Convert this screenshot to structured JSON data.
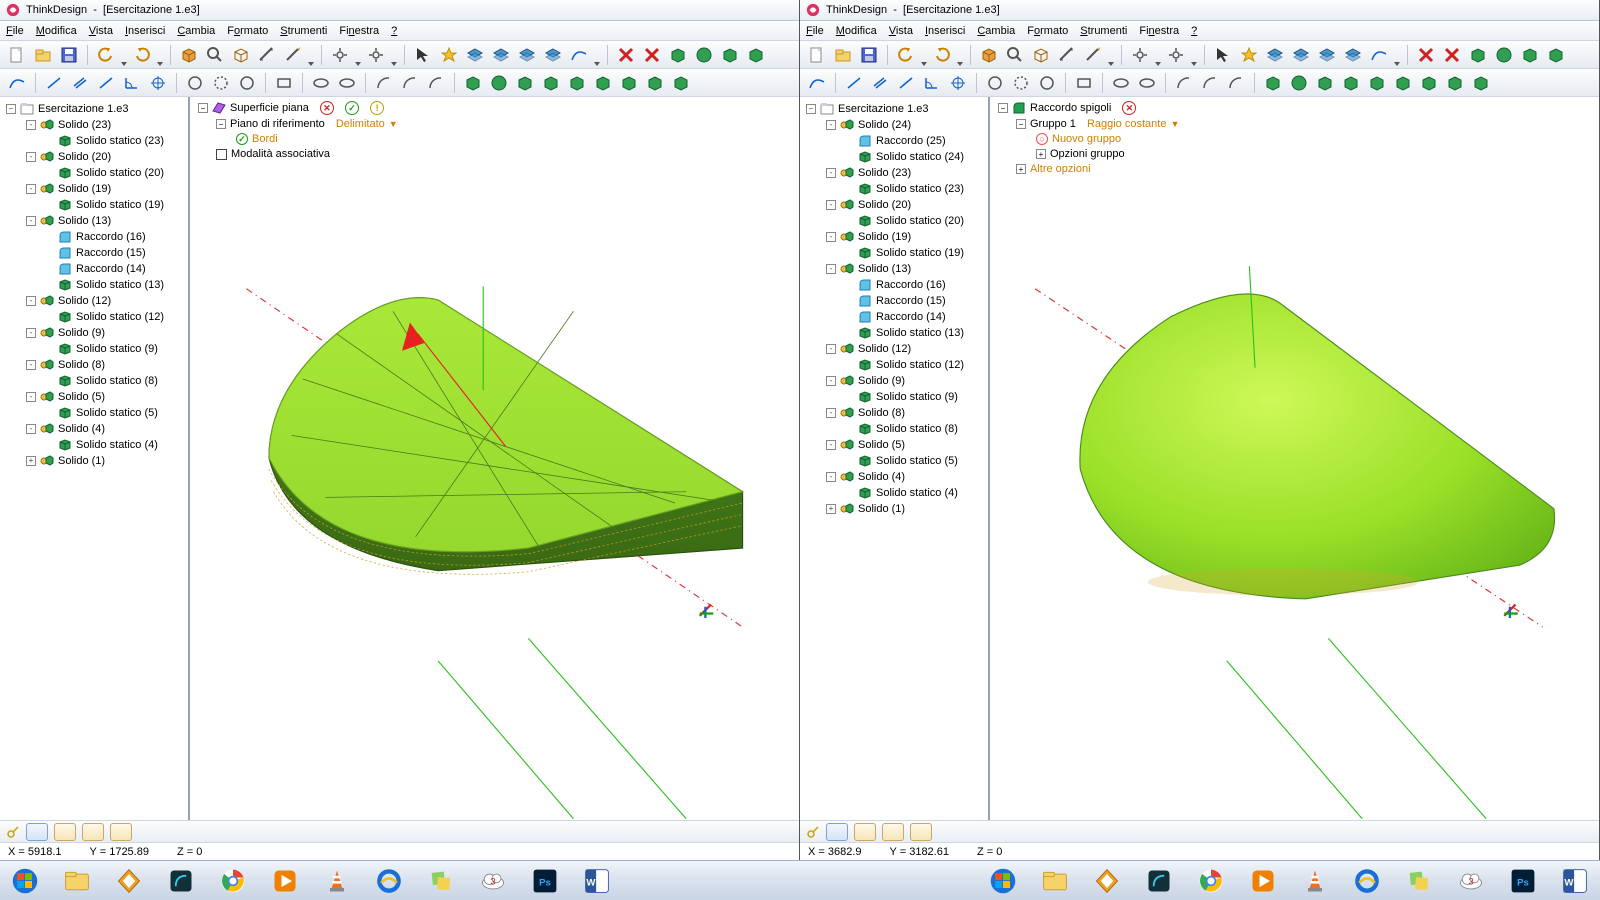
{
  "app_name": "ThinkDesign",
  "doc_name": "[Esercitazione 1.e3]",
  "menus": [
    "File",
    "Modifica",
    "Vista",
    "Inserisci",
    "Cambia",
    "Formato",
    "Strumenti",
    "Finestra",
    "?"
  ],
  "left": {
    "root": "Esercitazione 1.e3",
    "tree": [
      {
        "t": "s",
        "lbl": "Solido (23)",
        "exp": "-",
        "kids": [
          {
            "t": "ss",
            "lbl": "Solido statico (23)"
          }
        ]
      },
      {
        "t": "s",
        "lbl": "Solido (20)",
        "exp": "-",
        "kids": [
          {
            "t": "ss",
            "lbl": "Solido statico (20)"
          }
        ]
      },
      {
        "t": "s",
        "lbl": "Solido (19)",
        "exp": "-",
        "kids": [
          {
            "t": "ss",
            "lbl": "Solido statico (19)"
          }
        ]
      },
      {
        "t": "s",
        "lbl": "Solido (13)",
        "exp": "-",
        "kids": [
          {
            "t": "r",
            "lbl": "Raccordo (16)"
          },
          {
            "t": "r",
            "lbl": "Raccordo (15)"
          },
          {
            "t": "r",
            "lbl": "Raccordo (14)"
          },
          {
            "t": "ss",
            "lbl": "Solido statico (13)"
          }
        ]
      },
      {
        "t": "s",
        "lbl": "Solido (12)",
        "exp": "-",
        "kids": [
          {
            "t": "ss",
            "lbl": "Solido statico (12)"
          }
        ]
      },
      {
        "t": "s",
        "lbl": "Solido (9)",
        "exp": "-",
        "kids": [
          {
            "t": "ss",
            "lbl": "Solido statico (9)"
          }
        ]
      },
      {
        "t": "s",
        "lbl": "Solido (8)",
        "exp": "-",
        "kids": [
          {
            "t": "ss",
            "lbl": "Solido statico (8)"
          }
        ]
      },
      {
        "t": "s",
        "lbl": "Solido (5)",
        "exp": "-",
        "kids": [
          {
            "t": "ss",
            "lbl": "Solido statico (5)"
          }
        ]
      },
      {
        "t": "s",
        "lbl": "Solido (4)",
        "exp": "-",
        "kids": [
          {
            "t": "ss",
            "lbl": "Solido statico (4)"
          }
        ]
      },
      {
        "t": "s",
        "lbl": "Solido (1)",
        "exp": "+",
        "kids": []
      }
    ],
    "cmd": {
      "title": "Superficie piana",
      "ref": "Piano di riferimento",
      "refval": "Delimitato",
      "bordi": "Bordi",
      "assoc": "Modalità associativa"
    },
    "status": {
      "x": "X = 5918.1",
      "y": "Y = 1725.89",
      "z": "Z = 0"
    }
  },
  "right": {
    "root": "Esercitazione 1.e3",
    "tree": [
      {
        "t": "s",
        "lbl": "Solido (24)",
        "exp": "-",
        "kids": [
          {
            "t": "r",
            "lbl": "Raccordo (25)"
          },
          {
            "t": "ss",
            "lbl": "Solido statico (24)"
          }
        ]
      },
      {
        "t": "s",
        "lbl": "Solido (23)",
        "exp": "-",
        "kids": [
          {
            "t": "ss",
            "lbl": "Solido statico (23)"
          }
        ]
      },
      {
        "t": "s",
        "lbl": "Solido (20)",
        "exp": "-",
        "kids": [
          {
            "t": "ss",
            "lbl": "Solido statico (20)"
          }
        ]
      },
      {
        "t": "s",
        "lbl": "Solido (19)",
        "exp": "-",
        "kids": [
          {
            "t": "ss",
            "lbl": "Solido statico (19)"
          }
        ]
      },
      {
        "t": "s",
        "lbl": "Solido (13)",
        "exp": "-",
        "kids": [
          {
            "t": "r",
            "lbl": "Raccordo (16)"
          },
          {
            "t": "r",
            "lbl": "Raccordo (15)"
          },
          {
            "t": "r",
            "lbl": "Raccordo (14)"
          },
          {
            "t": "ss",
            "lbl": "Solido statico (13)"
          }
        ]
      },
      {
        "t": "s",
        "lbl": "Solido (12)",
        "exp": "-",
        "kids": [
          {
            "t": "ss",
            "lbl": "Solido statico (12)"
          }
        ]
      },
      {
        "t": "s",
        "lbl": "Solido (9)",
        "exp": "-",
        "kids": [
          {
            "t": "ss",
            "lbl": "Solido statico (9)"
          }
        ]
      },
      {
        "t": "s",
        "lbl": "Solido (8)",
        "exp": "-",
        "kids": [
          {
            "t": "ss",
            "lbl": "Solido statico (8)"
          }
        ]
      },
      {
        "t": "s",
        "lbl": "Solido (5)",
        "exp": "-",
        "kids": [
          {
            "t": "ss",
            "lbl": "Solido statico (5)"
          }
        ]
      },
      {
        "t": "s",
        "lbl": "Solido (4)",
        "exp": "-",
        "kids": [
          {
            "t": "ss",
            "lbl": "Solido statico (4)"
          }
        ]
      },
      {
        "t": "s",
        "lbl": "Solido (1)",
        "exp": "+",
        "kids": []
      }
    ],
    "cmd": {
      "title": "Raccordo spigoli",
      "group": "Gruppo 1",
      "groupval": "Raggio costante",
      "newgroup": "Nuovo gruppo",
      "groupopts": "Opzioni gruppo",
      "other": "Altre opzioni"
    },
    "status": {
      "x": "X = 3682.9",
      "y": "Y = 3182.61",
      "z": "Z = 0"
    }
  }
}
